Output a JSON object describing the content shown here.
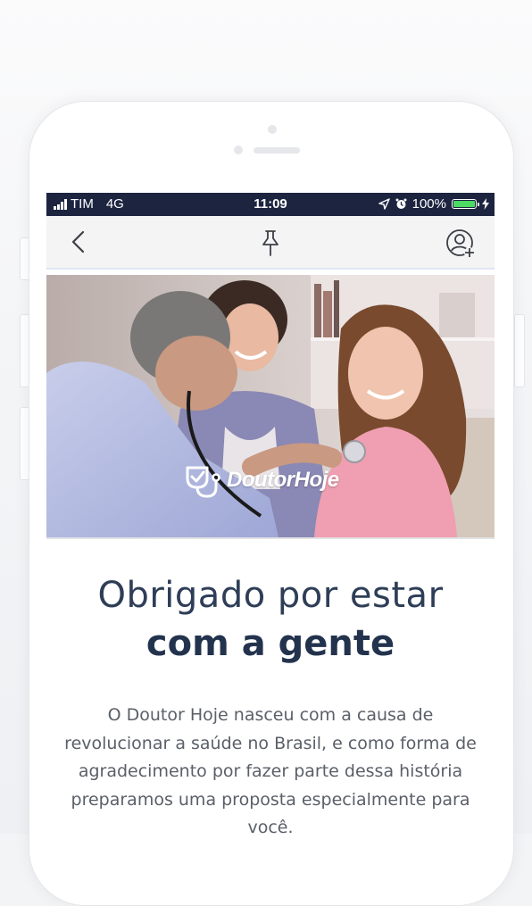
{
  "status_bar": {
    "carrier": "TIM",
    "network": "4G",
    "time": "11:09",
    "battery": "100%",
    "battery_level": 1.0,
    "battery_color": "#4cd964",
    "background": "#1c2440"
  },
  "nav": {
    "back_icon": "chevron-left-icon",
    "pin_icon": "pin-icon",
    "add_user_icon": "add-user-icon"
  },
  "hero": {
    "logo_text": "DoutorHoje",
    "logo_icon": "heart-stethoscope-icon"
  },
  "content": {
    "title_line1": "Obrigado por estar",
    "title_line2": "com a gente",
    "body": "O Doutor Hoje nasceu com a causa de revolucionar a saúde no Brasil, e como forma de agradecimento por fazer parte dessa história preparamos uma proposta especialmente para você."
  },
  "colors": {
    "title": "#2e3e57",
    "body_text": "#5a5f68",
    "nav_background": "#f4f4f5"
  }
}
